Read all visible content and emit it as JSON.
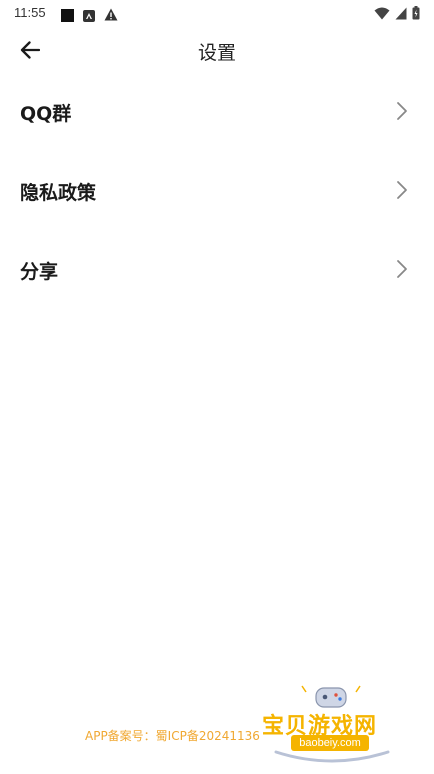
{
  "status_bar": {
    "time": "11:55",
    "icons": [
      "notification-square-icon",
      "app-a-icon",
      "warning-icon",
      "wifi-icon",
      "signal-icon",
      "battery-icon"
    ]
  },
  "header": {
    "title": "设置",
    "back_icon": "arrow-left-icon"
  },
  "settings": {
    "items": [
      {
        "label": "QQ群"
      },
      {
        "label": "隐私政策"
      },
      {
        "label": "分享"
      }
    ]
  },
  "footer": {
    "filing": "APP备案号：蜀ICP备20241136"
  },
  "watermark": {
    "brand": "宝贝游戏网",
    "domain": "baobeiy.com",
    "icon": "gamepad-logo-icon"
  },
  "colors": {
    "accent": "#f0a832",
    "text_primary": "#1a1a1a",
    "chevron": "#888888"
  }
}
